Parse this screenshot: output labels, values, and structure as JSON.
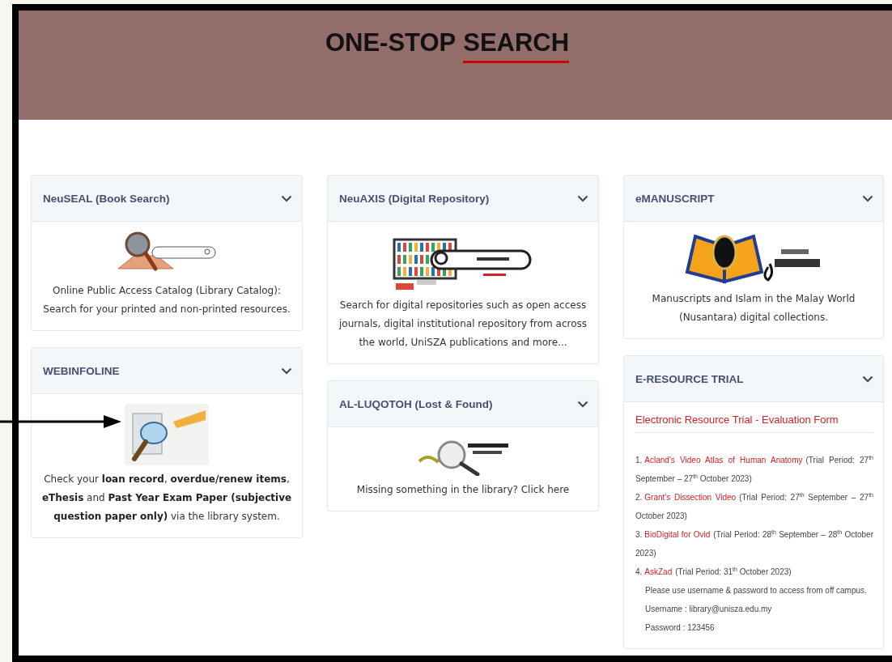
{
  "header": {
    "title_lead": "ONE-STOP",
    "title_accent": "SEARCH"
  },
  "columns": [
    [
      {
        "kind": "description",
        "title": "NeuSEAL (Book Search)",
        "expanded": true,
        "description": "Online Public Access Catalog (Library Catalog): Search for your printed and non-printed resources."
      },
      {
        "kind": "description",
        "title": "WEBINFOLINE",
        "expanded": true,
        "description": "Check your **loan record**, **overdue/renew items**, **eThesis** and **Past Year Exam Paper (subjective question paper only)** via the library system."
      }
    ],
    [
      {
        "kind": "description",
        "title": "NeuAXIS (Digital Repository)",
        "expanded": true,
        "description": "Search for digital repositories such as open access journals, digital institutional repository from across the world, UniSZA publications and more..."
      },
      {
        "kind": "description",
        "title": "AL-LUQOTOH (Lost & Found)",
        "expanded": true,
        "description": "Missing something in the library? Click here"
      }
    ],
    [
      {
        "kind": "description",
        "title": "eMANUSCRIPT",
        "expanded": true,
        "description": "Manuscripts and Islam in the Malay World (Nusantara) digital collections."
      },
      {
        "kind": "trial",
        "title": "E-RESOURCE TRIAL",
        "expanded": true,
        "form_link": "Electronic Resource Trial - Evaluation Form",
        "items": [
          {
            "number": "1.",
            "link": "Acland's Video Atlas of Human Anatomy",
            "period": "(Trial Period: 27$^{th}$ September – 27$^{th}$ October 2023)"
          },
          {
            "number": "2.",
            "link": "Grant's Dissection Video",
            "period": "(Trial Period: 27$^{th}$ September – 27$^{th}$ October 2023)"
          },
          {
            "number": "3.",
            "link": "BioDigital for Ovid",
            "period": "(Trial Period: 28$^{th}$ September – 28$^{th}$ October 2023)"
          },
          {
            "number": "4.",
            "link": "AskZad",
            "period": "(Trial Period: 31$^{th}$ October 2023)"
          }
        ],
        "notes": [
          "Please use username & password to access from off campus.",
          "Username : library@unisza.edu.my",
          "Password : 123456"
        ]
      }
    ]
  ]
}
